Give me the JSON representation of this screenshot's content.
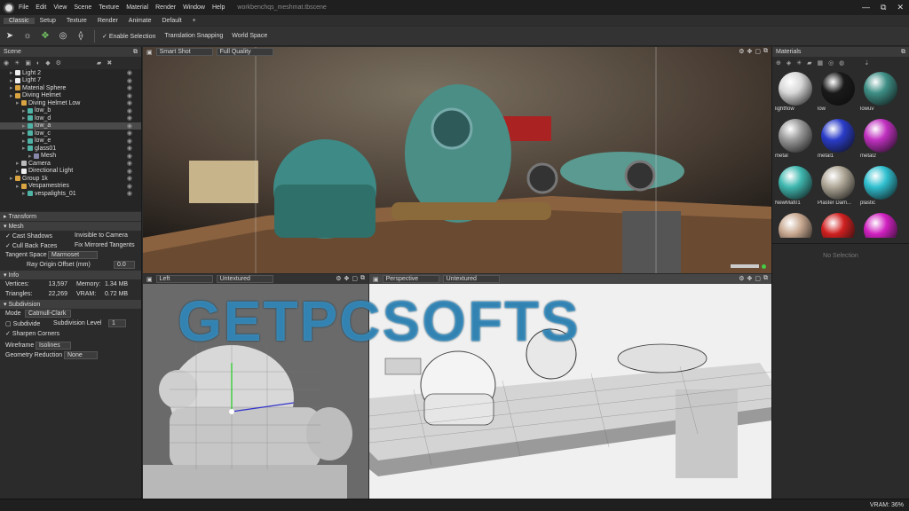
{
  "titlebar": {
    "menus": [
      "File",
      "Edit",
      "View",
      "Scene",
      "Texture",
      "Material",
      "Render",
      "Window",
      "Help"
    ],
    "window_title": "workbenchqs_meshmat.tbscene",
    "controls": [
      "—",
      "⧉",
      "✕"
    ]
  },
  "tabs": [
    "Classic",
    "Setup",
    "Texture",
    "Render",
    "Animate",
    "Default",
    "+"
  ],
  "toolbar": {
    "enable_selection": "Enable Selection",
    "translation_snapping": "Translation Snapping",
    "world_space": "World Space"
  },
  "scene": {
    "title": "Scene",
    "items": [
      {
        "label": "Light 2",
        "indent": 1,
        "color": "#eeeeee"
      },
      {
        "label": "Light 7",
        "indent": 1,
        "color": "#eeeeee"
      },
      {
        "label": "Material Sphere",
        "indent": 1,
        "color": "#d9a441"
      },
      {
        "label": "Diving Helmet",
        "indent": 1,
        "color": "#d9a441"
      },
      {
        "label": "Diving Helmet Low",
        "indent": 2,
        "color": "#d9a441"
      },
      {
        "label": "low_b",
        "indent": 3,
        "color": "#4fb3a6"
      },
      {
        "label": "low_d",
        "indent": 3,
        "color": "#4fb3a6"
      },
      {
        "label": "low_a",
        "indent": 3,
        "color": "#4fb3a6",
        "selected": true
      },
      {
        "label": "low_c",
        "indent": 3,
        "color": "#4fb3a6"
      },
      {
        "label": "low_e",
        "indent": 3,
        "color": "#4fb3a6"
      },
      {
        "label": "glass01",
        "indent": 3,
        "color": "#4fb3a6"
      },
      {
        "label": "Mesh",
        "indent": 4,
        "color": "#8888aa"
      },
      {
        "label": "Camera",
        "indent": 2,
        "color": "#bbbbbb"
      },
      {
        "label": "Directional Light",
        "indent": 2,
        "color": "#eeeeee"
      },
      {
        "label": "Group 1k",
        "indent": 1,
        "color": "#d9a441"
      },
      {
        "label": "Vespamestries",
        "indent": 2,
        "color": "#d9a441"
      },
      {
        "label": "vespalights_01",
        "indent": 3,
        "color": "#4fb3a6"
      }
    ]
  },
  "properties": {
    "transform": "Transform",
    "mesh": "Mesh",
    "cast_shadows": "Cast Shadows",
    "invisible_to_camera": "Invisible to Camera",
    "cull_back_faces": "Cull Back Faces",
    "fix_mirrored_tangents": "Fix Mirrored Tangents",
    "tangent_space_label": "Tangent Space",
    "tangent_space_value": "Marmoset",
    "ray_origin_label": "Ray Origin Offset (mm)",
    "ray_origin_value": "0.0",
    "info": "Info",
    "vertices_label": "Vertices:",
    "vertices_value": "13,597",
    "triangles_label": "Triangles:",
    "triangles_value": "22,269",
    "memory_label": "Memory:",
    "memory_value": "1.34 MB",
    "vram_label": "VRAM:",
    "vram_value": "0.72 MB",
    "subdivision": "Subdivision",
    "mode_label": "Mode",
    "mode_value": "Catmull-Clark",
    "subdivide_label": "Subdivide",
    "subdivision_level_label": "Subdivision Level",
    "subdivision_level_value": "1",
    "sharpen_corners": "Sharpen Corners",
    "wireframe_label": "Wireframe",
    "wireframe_value": "Isolines",
    "geometry_reduction_label": "Geometry Reduction",
    "geometry_reduction_value": "None"
  },
  "viewports": {
    "main": {
      "camera": "Smart Shot",
      "quality": "Full Quality"
    },
    "left": {
      "camera": "Left",
      "shading": "Untextured"
    },
    "perspective": {
      "camera": "Perspective",
      "shading": "Untextured"
    },
    "icons": [
      "⚙",
      "✥",
      "▢",
      "⧉"
    ]
  },
  "materials": {
    "title": "Materials",
    "items": [
      {
        "label": "lightflow",
        "color": "#d8d8d8"
      },
      {
        "label": "low",
        "color": "#1a1a1a"
      },
      {
        "label": "lowuv",
        "color": "#3e8f86"
      },
      {
        "label": "metal",
        "color": "#9a9a9a"
      },
      {
        "label": "metal1",
        "color": "#2a3cc8"
      },
      {
        "label": "metal2",
        "color": "#c030c0"
      },
      {
        "label": "NewMat01",
        "color": "#40b8b0"
      },
      {
        "label": "Plaster Dam...",
        "color": "#b0a898"
      },
      {
        "label": "plastic",
        "color": "#30c0d0"
      },
      {
        "label": "",
        "color": "#c8a890"
      },
      {
        "label": "",
        "color": "#d02020"
      },
      {
        "label": "",
        "color": "#d020c0"
      }
    ],
    "no_selection": "No Selection"
  },
  "status": {
    "vram": "VRAM: 36%"
  },
  "watermark": "GETPCSOFTS"
}
